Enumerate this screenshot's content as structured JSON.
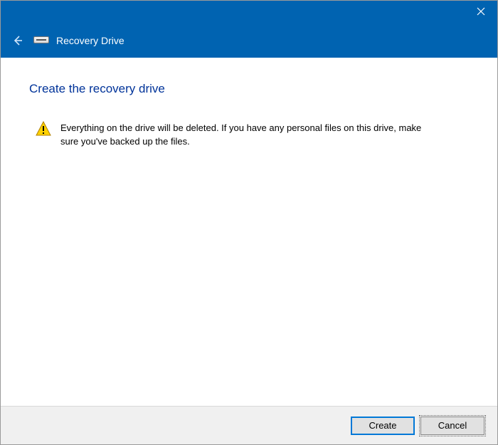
{
  "header": {
    "title": "Recovery Drive"
  },
  "page": {
    "title": "Create the recovery drive",
    "warning_text": "Everything on the drive will be deleted. If you have any personal files on this drive, make sure you've backed up the files."
  },
  "footer": {
    "create_label": "Create",
    "cancel_label": "Cancel"
  }
}
